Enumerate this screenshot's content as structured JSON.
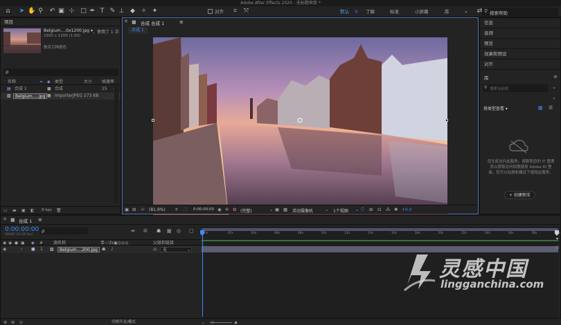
{
  "app": {
    "title": "Adobe After Effects 2020 - 无标题项目 *"
  },
  "toolbar": {
    "align_label": "对齐",
    "workspaces": [
      "默认",
      "了解",
      "标准",
      "小屏幕",
      "库"
    ],
    "more": "»",
    "search_placeholder": "搜索帮助"
  },
  "project": {
    "title": "项目",
    "asset_name": "Belgium....0x1200.jpg ▾",
    "used_by": "，使用了 1 次",
    "asset_dims": "1920 x 1200 (1.00)",
    "asset_color": "数百万种颜色",
    "search_placeholder": "ρ",
    "columns": {
      "name": "名称",
      "type": "类型",
      "size": "大小",
      "fps": "帧速率"
    },
    "items": [
      {
        "name": "合成 1",
        "type": "合成",
        "size": "",
        "fps": "25"
      },
      {
        "name": "Belgium.....jpg",
        "type": "ImporterJPEG",
        "size": "273 KB",
        "fps": ""
      }
    ],
    "bpc": "8 bpc"
  },
  "composition": {
    "panel_title": "合成 合成 1",
    "panel_menu": "≡",
    "tab": "合成 1",
    "zoom": "(81.9%)",
    "timecode": "0:00:00:00",
    "resolution": "(完整)",
    "camera": "活动摄像机",
    "views": "1个视图",
    "exposure": "+0.0"
  },
  "right_panel": {
    "items": [
      "信息",
      "音频",
      "预览",
      "效果和预设",
      "对齐"
    ],
    "library_title": "库",
    "library_menu": "≡",
    "library_search": "搜索当前库",
    "view_by": "按类型查看 ▾",
    "message": "您无权访问此服务。请联系您的 IT 管理员以获取访问权限使用 Adobe ID 登录。您可以在脱机模式下使用此服务。",
    "create_button": "+ 创建新库"
  },
  "timeline": {
    "tab": "合成 1",
    "tab_menu": "≡",
    "timecode": "0:00:00:00",
    "timecode_sub": "00000 (25.00 fps)",
    "search": "ρ",
    "col_source": "源名称",
    "col_switches": "单☆\\fx▣◎◎◎",
    "col_parent": "父级和链接",
    "layer": {
      "index": "1",
      "name": "Belgium....200.jpg",
      "parent": "无"
    },
    "ruler": [
      "0s",
      "02s",
      "04s",
      "06s",
      "08s",
      "10s",
      "12s",
      "14s",
      "16s",
      "18s",
      "20s",
      "22s",
      "24s",
      "26s",
      "28s",
      "30s"
    ],
    "footer_mode": "切换开关/模式"
  },
  "watermark": {
    "brand_cn": "灵感中国",
    "brand_url": "lingganchina.com"
  },
  "colors": {
    "accent": "#3d8bff",
    "panel": "#232323",
    "bg": "#1d1d1d",
    "timeline_bar": "#5b5e70"
  }
}
